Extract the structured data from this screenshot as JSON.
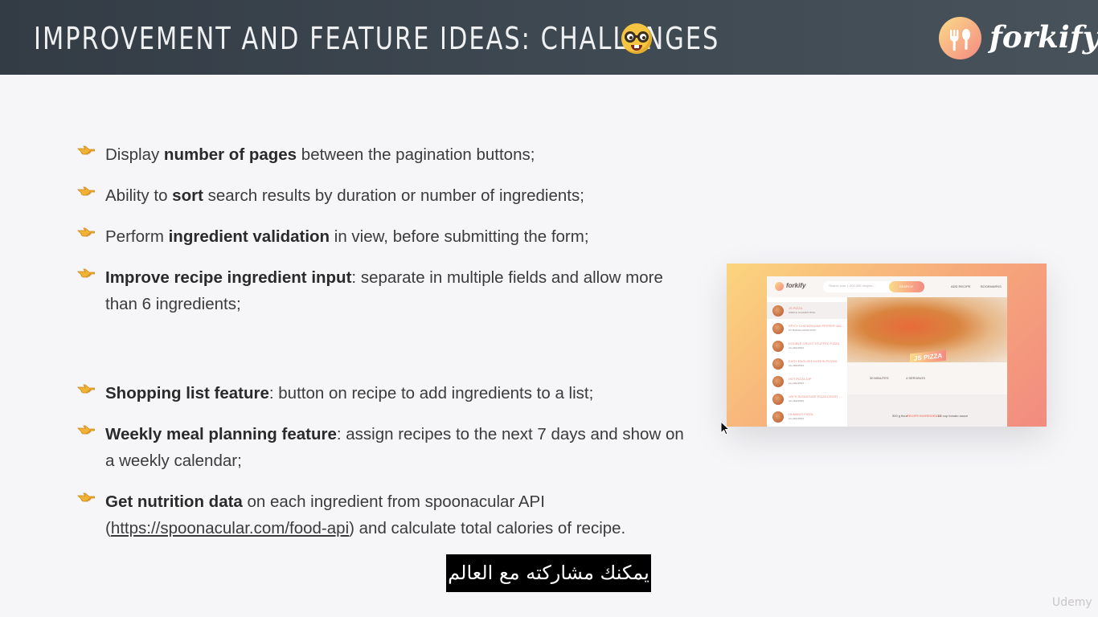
{
  "header": {
    "title": "Improvement and feature ideas: challenges",
    "emoji_icon": "nerd-face-icon",
    "logo_text": "forkify",
    "logo_icon": "fork-spoon-icon",
    "colors": {
      "header_bg": "#3e4851",
      "logo_gradient_start": "#fbdb89",
      "logo_gradient_end": "#f48982"
    }
  },
  "bullets": [
    {
      "icon": "pointing-hand-icon",
      "parts": [
        {
          "text": "Display ",
          "bold": false
        },
        {
          "text": "number of pages",
          "bold": true
        },
        {
          "text": " between the pagination buttons;",
          "bold": false
        }
      ]
    },
    {
      "icon": "pointing-hand-icon",
      "parts": [
        {
          "text": "Ability to ",
          "bold": false
        },
        {
          "text": "sort",
          "bold": true
        },
        {
          "text": " search results by duration or number of ingredients;",
          "bold": false
        }
      ]
    },
    {
      "icon": "pointing-hand-icon",
      "parts": [
        {
          "text": "Perform ",
          "bold": false
        },
        {
          "text": "ingredient validation",
          "bold": true
        },
        {
          "text": " in view, before submitting the form;",
          "bold": false
        }
      ]
    },
    {
      "icon": "pointing-hand-icon",
      "parts": [
        {
          "text": "Improve recipe ingredient input",
          "bold": true
        },
        {
          "text": ": separate in multiple fields and allow more than 6 ingredients;",
          "bold": false
        }
      ]
    },
    {
      "icon": "pointing-hand-icon",
      "parts": [
        {
          "text": "Shopping list feature",
          "bold": true
        },
        {
          "text": ": button on recipe to add ingredients to a list;",
          "bold": false
        }
      ]
    },
    {
      "icon": "pointing-hand-icon",
      "parts": [
        {
          "text": "Weekly meal planning feature",
          "bold": true
        },
        {
          "text": ": assign recipes to the next 7 days and show on a weekly calendar;",
          "bold": false
        }
      ]
    },
    {
      "icon": "pointing-hand-icon",
      "parts": [
        {
          "text": "Get nutrition data",
          "bold": true
        },
        {
          "text": " on each ingredient from spoonacular API (",
          "bold": false
        },
        {
          "text": "https://spoonacular.com/food-api",
          "bold": false,
          "link": true
        },
        {
          "text": ") and calculate total calories of recipe.",
          "bold": false
        }
      ]
    }
  ],
  "preview": {
    "logo": "forkify",
    "search_placeholder": "Search over 1,000,000 recipes...",
    "search_button": "SEARCH",
    "nav_add": "ADD RECIPE",
    "nav_bookmarks": "BOOKMARKS",
    "results": [
      {
        "name": "JS PIZZA",
        "publisher": "SIMPLE SCHMIDT BISH"
      },
      {
        "name": "SPICY CHICKEN AND PEPPER JAC...",
        "publisher": "MY BAKING ADDICTION"
      },
      {
        "name": "DOUBLE CRUST STUFFED PIZZA",
        "publisher": "ALL RECIPES"
      },
      {
        "name": "EASY ENGLISH MUFFIN PIZZAS",
        "publisher": "ALL RECIPES"
      },
      {
        "name": "HOT PIZZA DIP",
        "publisher": "ALL RECIPES"
      },
      {
        "name": "JAY'S SIGNATURE PIZZA CRUST ...",
        "publisher": "ALL RECIPES"
      },
      {
        "name": "HUMMUS PIZZA",
        "publisher": "ALL RECIPES"
      }
    ],
    "recipe_title": "JS PIZZA",
    "minutes": "30 MINUTES",
    "servings": "4 SERVINGS",
    "ingredients_title": "RECIPE INGREDIENTS",
    "ingredient_1": "500 g flour",
    "ingredient_2": "1/2 cup tomato sauce"
  },
  "subtitle": "يمكنك مشاركته مع العالم",
  "watermark": "Udemy"
}
